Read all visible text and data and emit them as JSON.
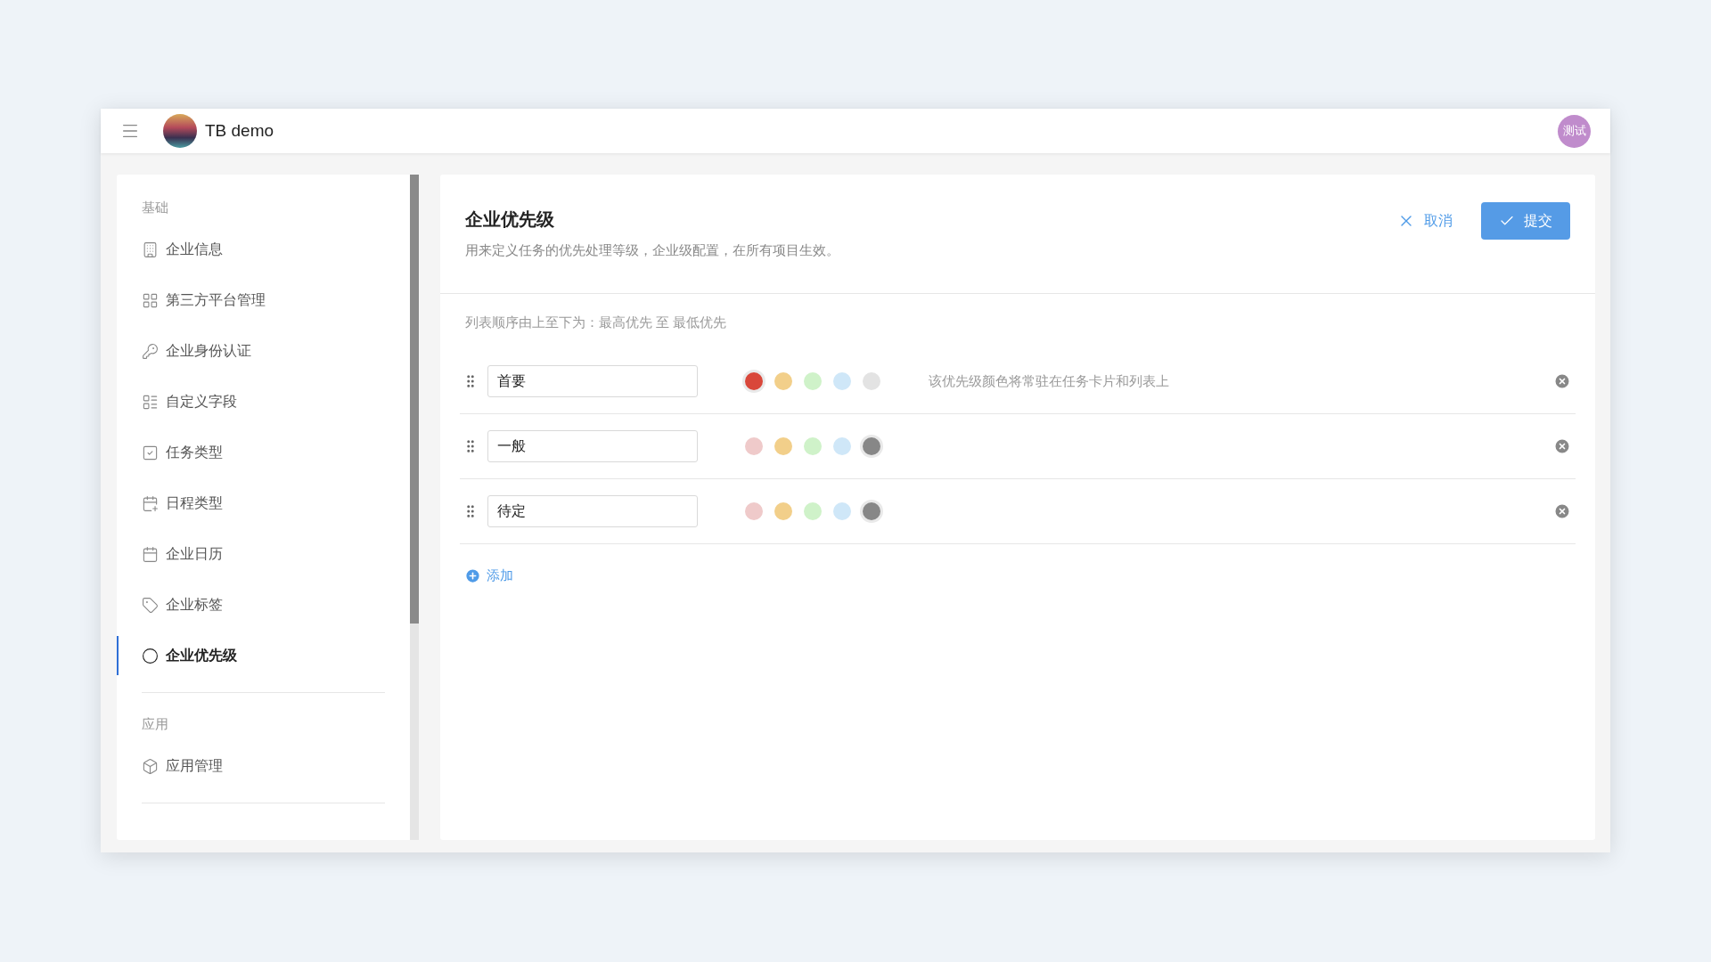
{
  "header": {
    "title": "TB demo",
    "user_avatar": "测试"
  },
  "sidebar": {
    "sections": [
      {
        "title": "基础",
        "items": [
          {
            "label": "企业信息",
            "selected": false
          },
          {
            "label": "第三方平台管理",
            "selected": false
          },
          {
            "label": "企业身份认证",
            "selected": false
          },
          {
            "label": "自定义字段",
            "selected": false
          },
          {
            "label": "任务类型",
            "selected": false
          },
          {
            "label": "日程类型",
            "selected": false
          },
          {
            "label": "企业日历",
            "selected": false
          },
          {
            "label": "企业标签",
            "selected": false
          },
          {
            "label": "企业优先级",
            "selected": true
          }
        ]
      },
      {
        "title": "应用",
        "items": [
          {
            "label": "应用管理",
            "selected": false
          }
        ]
      }
    ]
  },
  "content": {
    "title": "企业优先级",
    "description": "用来定义任务的优先处理等级，企业级配置，在所有项目生效。",
    "cancel": "取消",
    "submit": "提交",
    "order_hint": "列表顺序由上至下为：最高优先 至 最低优先",
    "rows": [
      {
        "name": "首要",
        "hint": "该优先级颜色将常驻在任务卡片和列表上",
        "swatches": [
          {
            "color": "#d9473a",
            "selected": true
          },
          {
            "color": "#f2cf8a",
            "selected": false
          },
          {
            "color": "#cff2c9",
            "selected": false
          },
          {
            "color": "#cfe7f8",
            "selected": false
          },
          {
            "color": "#e3e3e3",
            "selected": false
          }
        ]
      },
      {
        "name": "一般",
        "swatches": [
          {
            "color": "#efcaca",
            "selected": false
          },
          {
            "color": "#f2cf8a",
            "selected": false
          },
          {
            "color": "#cff2c9",
            "selected": false
          },
          {
            "color": "#cfe7f8",
            "selected": false
          },
          {
            "color": "#878787",
            "selected": true
          }
        ]
      },
      {
        "name": "待定",
        "swatches": [
          {
            "color": "#efcaca",
            "selected": false
          },
          {
            "color": "#f2cf8a",
            "selected": false
          },
          {
            "color": "#cff2c9",
            "selected": false
          },
          {
            "color": "#cfe7f8",
            "selected": false
          },
          {
            "color": "#878787",
            "selected": true
          }
        ]
      }
    ],
    "add": "添加"
  }
}
